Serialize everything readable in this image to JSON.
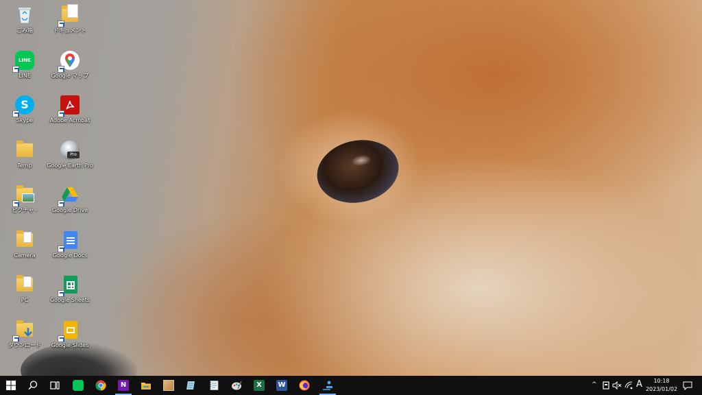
{
  "desktop": {
    "icons": [
      {
        "label": "ごみ箱",
        "icon": "recycle-bin-icon"
      },
      {
        "label": "ドキュメント",
        "icon": "documents-folder-icon"
      },
      {
        "label": "LINE",
        "icon": "line-app-icon"
      },
      {
        "label": "Google マップ",
        "icon": "google-maps-icon"
      },
      {
        "label": "Skype",
        "icon": "skype-icon"
      },
      {
        "label": "Adobe Acrobat",
        "icon": "adobe-acrobat-icon"
      },
      {
        "label": "Temp",
        "icon": "folder-icon"
      },
      {
        "label": "Google Earth Pro",
        "icon": "google-earth-pro-icon"
      },
      {
        "label": "ピクチャ -",
        "icon": "pictures-folder-icon"
      },
      {
        "label": "Google Drive",
        "icon": "google-drive-icon"
      },
      {
        "label": "Camera",
        "icon": "folder-icon"
      },
      {
        "label": "Google Docs",
        "icon": "google-docs-icon"
      },
      {
        "label": "PC",
        "icon": "folder-icon"
      },
      {
        "label": "Google Sheets",
        "icon": "google-sheets-icon"
      },
      {
        "label": "ダウンロード",
        "icon": "downloads-folder-icon"
      },
      {
        "label": "Google Slides",
        "icon": "google-slides-icon"
      }
    ],
    "glyphs": {
      "line": "LINE",
      "skype": "S",
      "earth_pro": "Pro"
    }
  },
  "taskbar": {
    "items": [
      {
        "name": "start-button",
        "icon": "windows-logo-icon"
      },
      {
        "name": "search-button",
        "icon": "search-icon"
      },
      {
        "name": "task-view-button",
        "icon": "task-view-icon"
      },
      {
        "name": "line-taskbar",
        "icon": "line-app-icon"
      },
      {
        "name": "chrome-taskbar",
        "icon": "chrome-icon"
      },
      {
        "name": "onenote-taskbar",
        "icon": "onenote-icon"
      },
      {
        "name": "file-explorer-taskbar",
        "icon": "file-explorer-icon"
      },
      {
        "name": "photos-taskbar",
        "icon": "photos-icon"
      },
      {
        "name": "notepad-taskbar",
        "icon": "notepad-icon"
      },
      {
        "name": "notebook-taskbar",
        "icon": "notebook-icon"
      },
      {
        "name": "paint-taskbar",
        "icon": "paint-icon"
      },
      {
        "name": "excel-taskbar",
        "icon": "excel-icon"
      },
      {
        "name": "word-taskbar",
        "icon": "word-icon"
      },
      {
        "name": "firefox-taskbar",
        "icon": "firefox-icon"
      },
      {
        "name": "people-taskbar",
        "icon": "people-icon"
      }
    ],
    "glyphs": {
      "onenote": "N",
      "excel": "X",
      "word": "W"
    },
    "tray": {
      "chevron": "^",
      "ime": "A",
      "time": "10:18",
      "date": "2023/01/02"
    }
  },
  "colors": {
    "taskbar_bg": "#101010",
    "active_indicator": "#7ab3ff",
    "line_green": "#06c755",
    "skype_blue": "#00aff0",
    "acrobat_red": "#c5110d",
    "excel_green": "#1d6f42",
    "word_blue": "#2b579a",
    "onenote_purple": "#7719aa"
  }
}
